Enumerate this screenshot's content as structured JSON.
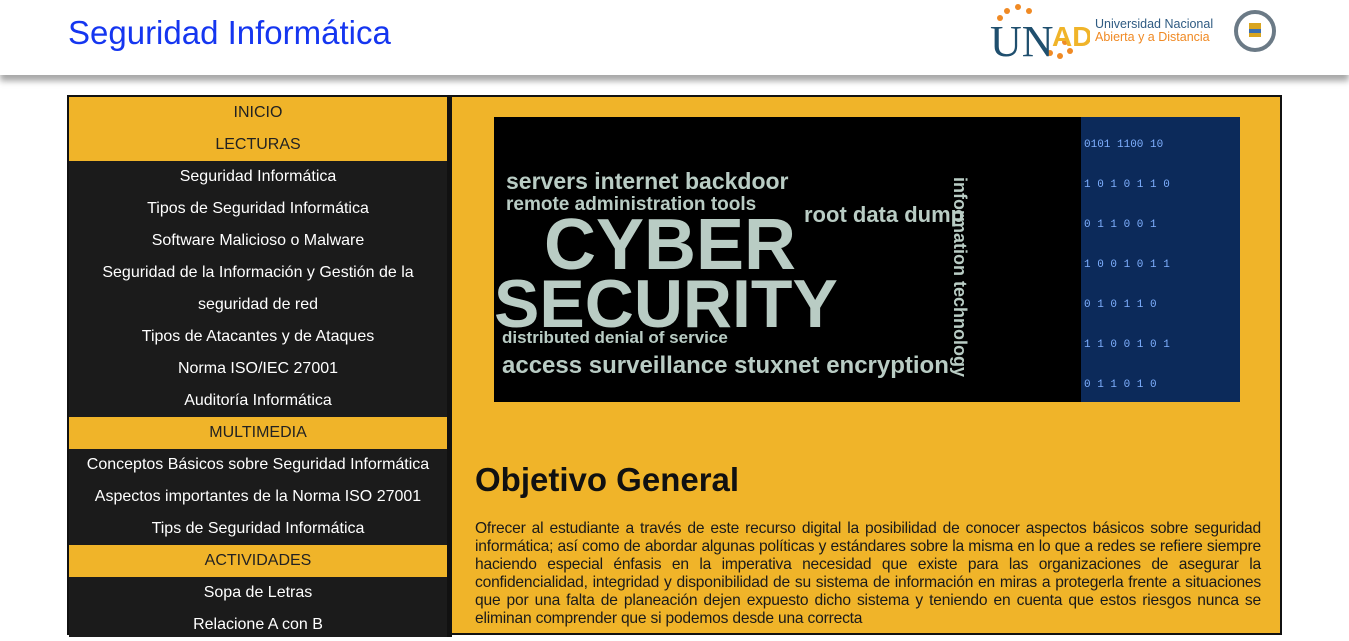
{
  "header": {
    "title": "Seguridad Informática",
    "logo": {
      "acronym": "UNAD",
      "line1": "Universidad Nacional",
      "line2": "Abierta y a Distancia"
    }
  },
  "sidebar": {
    "items": [
      {
        "label": "INICIO",
        "section": true
      },
      {
        "label": "LECTURAS",
        "section": true
      },
      {
        "label": "Seguridad Informática"
      },
      {
        "label": "Tipos de Seguridad Informática"
      },
      {
        "label": "Software Malicioso o Malware"
      },
      {
        "label": "Seguridad de la Información y Gestión de la"
      },
      {
        "label": "seguridad de red"
      },
      {
        "label": "Tipos de Atacantes y de Ataques"
      },
      {
        "label": "Norma ISO/IEC 27001"
      },
      {
        "label": "Auditoría Informática"
      },
      {
        "label": "MULTIMEDIA",
        "section": true
      },
      {
        "label": "Conceptos Básicos sobre Seguridad Informática"
      },
      {
        "label": "Aspectos importantes de la Norma ISO 27001"
      },
      {
        "label": "Tips de Seguridad Informática"
      },
      {
        "label": "ACTIVIDADES",
        "section": true
      },
      {
        "label": "Sopa de Letras"
      },
      {
        "label": "Relacione A con B"
      }
    ]
  },
  "main": {
    "banner_words": {
      "w1": "CYBER",
      "w2": "SECURITY",
      "w3": "servers internet backdoor",
      "w4": "remote administration tools",
      "w5": "root data dump",
      "w6": "distributed denial of service",
      "w7": "access surveillance stuxnet encryption",
      "w8": "information technology"
    },
    "heading": "Objetivo General",
    "paragraph": "Ofrecer al estudiante a través de este recurso digital la posibilidad de conocer aspectos básicos sobre seguridad informática; así como de abordar algunas políticas y estándares sobre la misma en lo que a redes se refiere siempre haciendo especial énfasis en la imperativa necesidad que existe para las organizaciones de asegurar la confidencialidad, integridad y disponibilidad de su sistema de información en miras a protegerla frente a situaciones que por una falta de planeación dejen expuesto dicho sistema y teniendo en cuenta que estos riesgos nunca se eliminan comprender que si podemos desde una correcta"
  }
}
